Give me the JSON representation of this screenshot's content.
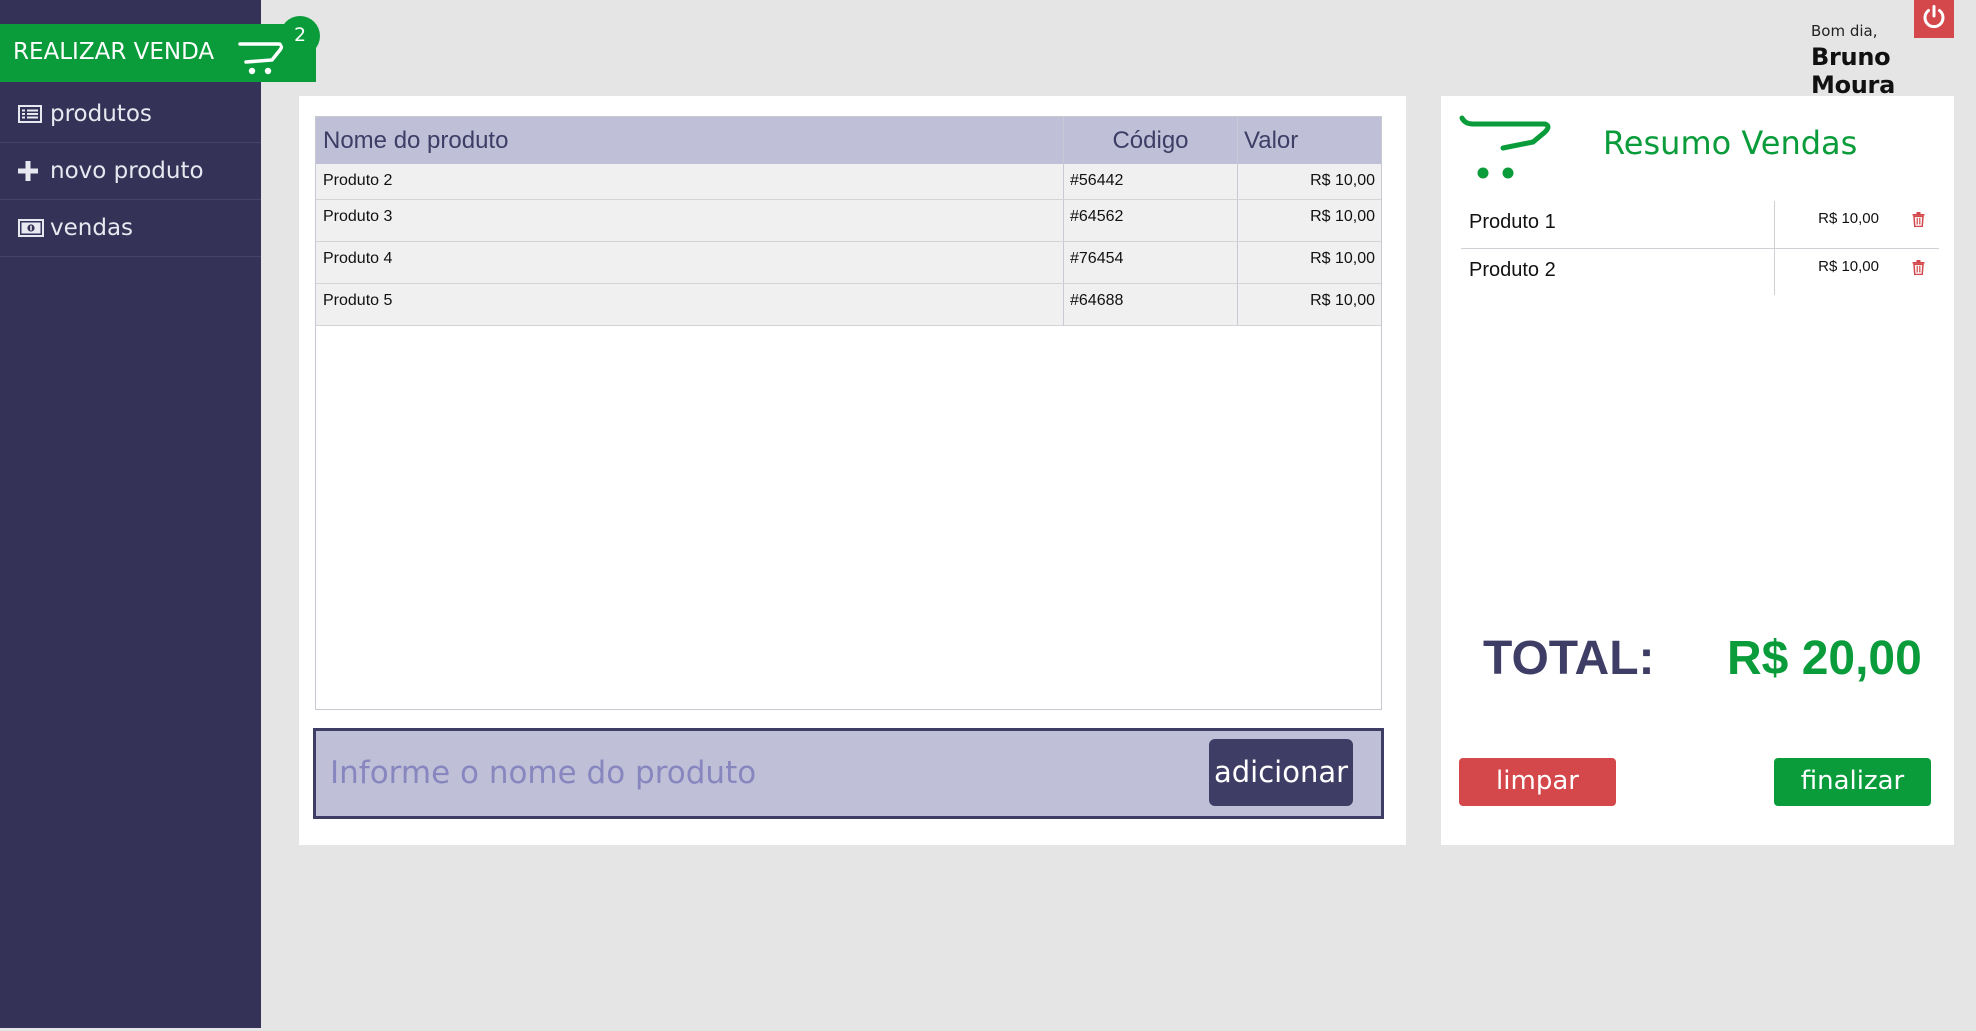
{
  "sidebar": {
    "sell_button": {
      "label": "REALIZAR VENDA",
      "icon": "shopping-cart-icon",
      "badge": "2"
    },
    "items": [
      {
        "label": "produtos",
        "icon": "list-icon"
      },
      {
        "label": "novo produto",
        "icon": "plus-icon"
      },
      {
        "label": "vendas",
        "icon": "money-icon"
      }
    ]
  },
  "header": {
    "greeting": "Bom dia,",
    "user_name": "Bruno Moura",
    "power_icon": "power-icon"
  },
  "products_table": {
    "columns": [
      "Nome do produto",
      "Código",
      "Valor"
    ],
    "rows": [
      {
        "name": "Produto 2",
        "code": "#56442",
        "value": "R$ 10,00"
      },
      {
        "name": "Produto 3",
        "code": "#64562",
        "value": "R$ 10,00"
      },
      {
        "name": "Produto 4",
        "code": "#76454",
        "value": "R$ 10,00"
      },
      {
        "name": "Produto 5",
        "code": "#64688",
        "value": "R$ 10,00"
      }
    ]
  },
  "add_bar": {
    "placeholder": "Informe o nome do produto",
    "button_label": "adicionar"
  },
  "summary": {
    "title": "Resumo Vendas",
    "items": [
      {
        "name": "Produto 1",
        "value": "R$ 10,00",
        "icon": "trash-icon"
      },
      {
        "name": "Produto 2",
        "value": "R$ 10,00",
        "icon": "trash-icon"
      }
    ],
    "total_label": "TOTAL:",
    "total_value": "R$ 20,00",
    "clear_label": "limpar",
    "finish_label": "finalizar"
  },
  "colors": {
    "sidebar": "#343256",
    "green": "#0a9c3a",
    "red": "#d4474a",
    "indigo": "#3e3d66",
    "lavender": "#bfc0d8"
  }
}
